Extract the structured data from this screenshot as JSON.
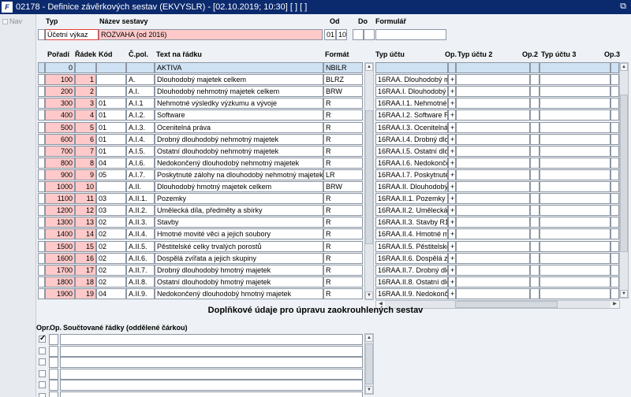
{
  "window": {
    "title": "02178 - Definice závěrkových sestav (EKVYSLR) - [02.10.2019; 10:30]  [ ]  [ ]",
    "app_icon": "F"
  },
  "nav": {
    "label": "Nav"
  },
  "header": {
    "typ_label": "Typ",
    "nazev_label": "Název sestavy",
    "od_label": "Od",
    "do_label": "Do",
    "formular_label": "Formulář",
    "typ_value": "Účetní výkaz",
    "nazev_value": "ROZVAHA (od 2016)",
    "od_1": "01",
    "od_2": "10",
    "do_1": "",
    "do_2": "",
    "formular_value": ""
  },
  "grid": {
    "columns": {
      "poradi": "Pořadí",
      "radek": "Řádek",
      "kod": "Kód",
      "cpol": "Č.pol.",
      "text": "Text na řádku",
      "format": "Formát"
    },
    "rows": [
      {
        "poradi": "0",
        "radek": "",
        "kod": "",
        "cpol": "",
        "text": "AKTIVA",
        "format": "NBILR",
        "selected": true
      },
      {
        "poradi": "100",
        "radek": "1",
        "kod": "",
        "cpol": "A.",
        "text": "Dlouhodobý majetek celkem",
        "format": "BLRZ"
      },
      {
        "poradi": "200",
        "radek": "2",
        "kod": "",
        "cpol": "A.I.",
        "text": "Dlouhodobý nehmotný majetek celkem",
        "format": "BRW"
      },
      {
        "poradi": "300",
        "radek": "3",
        "kod": "01",
        "cpol": "A.I.1",
        "text": "Nehmotné výsledky výzkumu a vývoje",
        "format": "R"
      },
      {
        "poradi": "400",
        "radek": "4",
        "kod": "01",
        "cpol": "A.I.2.",
        "text": "Software",
        "format": "R"
      },
      {
        "poradi": "500",
        "radek": "5",
        "kod": "01",
        "cpol": "A.I.3.",
        "text": "Ocenitelná práva",
        "format": "R"
      },
      {
        "poradi": "600",
        "radek": "6",
        "kod": "01",
        "cpol": "A.I.4.",
        "text": "Drobný dlouhodobý nehmotný majetek",
        "format": "R"
      },
      {
        "poradi": "700",
        "radek": "7",
        "kod": "01",
        "cpol": "A.I.5.",
        "text": "Ostatní dlouhodobý nehmotný majetek",
        "format": "R"
      },
      {
        "poradi": "800",
        "radek": "8",
        "kod": "04",
        "cpol": "A.I.6.",
        "text": "Nedokončený dlouhodobý nehmotný majetek",
        "format": "R"
      },
      {
        "poradi": "900",
        "radek": "9",
        "kod": "05",
        "cpol": "A.I.7.",
        "text": "Poskytnuté zálohy na dlouhodobý nehmotný majetek",
        "format": "LR"
      },
      {
        "poradi": "1000",
        "radek": "10",
        "kod": "",
        "cpol": "A.II.",
        "text": "Dlouhodobý hmotný majetek celkem",
        "format": "BRW"
      },
      {
        "poradi": "1100",
        "radek": "11",
        "kod": "03",
        "cpol": "A.II.1.",
        "text": "Pozemky",
        "format": "R"
      },
      {
        "poradi": "1200",
        "radek": "12",
        "kod": "03",
        "cpol": "A.II.2.",
        "text": "Umělecká díla, předměty a sbírky",
        "format": "R"
      },
      {
        "poradi": "1300",
        "radek": "13",
        "kod": "02",
        "cpol": "A.II.3.",
        "text": "Stavby",
        "format": "R"
      },
      {
        "poradi": "1400",
        "radek": "14",
        "kod": "02",
        "cpol": "A.II.4.",
        "text": "Hmotné movité věci a jejich soubory",
        "format": "R"
      },
      {
        "poradi": "1500",
        "radek": "15",
        "kod": "02",
        "cpol": "A.II.5.",
        "text": "Pěstitelské celky trvalých porostů",
        "format": "R"
      },
      {
        "poradi": "1600",
        "radek": "16",
        "kod": "02",
        "cpol": "A.II.6.",
        "text": "Dospělá zvířata a jejich skupiny",
        "format": "R"
      },
      {
        "poradi": "1700",
        "radek": "17",
        "kod": "02",
        "cpol": "A.II.7.",
        "text": "Drobný dlouhodobý hmotný majetek",
        "format": "R"
      },
      {
        "poradi": "1800",
        "radek": "18",
        "kod": "02",
        "cpol": "A.II.8.",
        "text": "Ostatní dlouhodobý hmotný majetek",
        "format": "R"
      },
      {
        "poradi": "1900",
        "radek": "19",
        "kod": "04",
        "cpol": "A.II.9.",
        "text": "Nedokončený dlouhodobý hmotný majetek",
        "format": "R"
      }
    ]
  },
  "right_grid": {
    "columns": {
      "typ_uctu": "Typ účtu",
      "op": "Op.",
      "typ_uctu_2": "Typ účtu 2",
      "op2": "Op.2",
      "typ_uctu_3": "Typ účtu 3",
      "op3": "Op.3"
    },
    "rows": [
      {
        "typ": "",
        "op": ""
      },
      {
        "typ": "16RAA.  Dlouhodobý maj",
        "op": "+"
      },
      {
        "typ": "16RAA.I.  Dlouhodobý ne",
        "op": "+"
      },
      {
        "typ": "16RAA.I.1.  Nehmotné vý",
        "op": "+"
      },
      {
        "typ": "16RAA.I.2.  Software R4",
        "op": "+"
      },
      {
        "typ": "16RAA.I.3.  Ocenitelná p",
        "op": "+"
      },
      {
        "typ": "16RAA.I.4.  Drobný dlouh",
        "op": "+"
      },
      {
        "typ": "16RAA.I.5.  Ostatní dlouh",
        "op": "+"
      },
      {
        "typ": "16RAA.I.6.  Nedokončen",
        "op": "+"
      },
      {
        "typ": "16RAA.I.7.  Poskytnuté z",
        "op": "+"
      },
      {
        "typ": "16RAA.II.  Dlouhodobý hi",
        "op": "+"
      },
      {
        "typ": "16RAA.II.1.  Pozemky R1",
        "op": "+"
      },
      {
        "typ": "16RAA.II.2.  Umělecká díl",
        "op": "+"
      },
      {
        "typ": "16RAA.II.3.  Stavby R13",
        "op": "+"
      },
      {
        "typ": "16RAA.II.4.  Hmotné mov",
        "op": "+"
      },
      {
        "typ": "16RAA.II.5.  Pěstitelské c",
        "op": "+"
      },
      {
        "typ": "16RAA.II.6.  Dospělá zvíř",
        "op": "+"
      },
      {
        "typ": "16RAA.II.7.  Drobný dlou",
        "op": "+"
      },
      {
        "typ": "16RAA.II.8.  Ostatní dlou",
        "op": "+"
      },
      {
        "typ": "16RAA.II.9.  Nedokončen",
        "op": "+"
      }
    ]
  },
  "bottom": {
    "section_title": "Doplňkové údaje pro úpravu zaokrouhlených sestav",
    "opr_label": "Opr.",
    "op_label": "Op.",
    "soucet_label": "Součtované řádky (oddělené čárkou)",
    "rows": [
      {
        "opr": true,
        "op": "",
        "value": ""
      },
      {
        "opr": false,
        "op": "",
        "value": ""
      },
      {
        "opr": false,
        "op": "",
        "value": ""
      },
      {
        "opr": false,
        "op": "",
        "value": ""
      },
      {
        "opr": false,
        "op": "",
        "value": ""
      },
      {
        "opr": false,
        "op": "",
        "value": ""
      }
    ]
  },
  "colors": {
    "titlebar": "#0b2a6e",
    "pink_cell": "#ffc9c9",
    "selected_row": "#cfe2f3",
    "background": "#eef1f5"
  }
}
